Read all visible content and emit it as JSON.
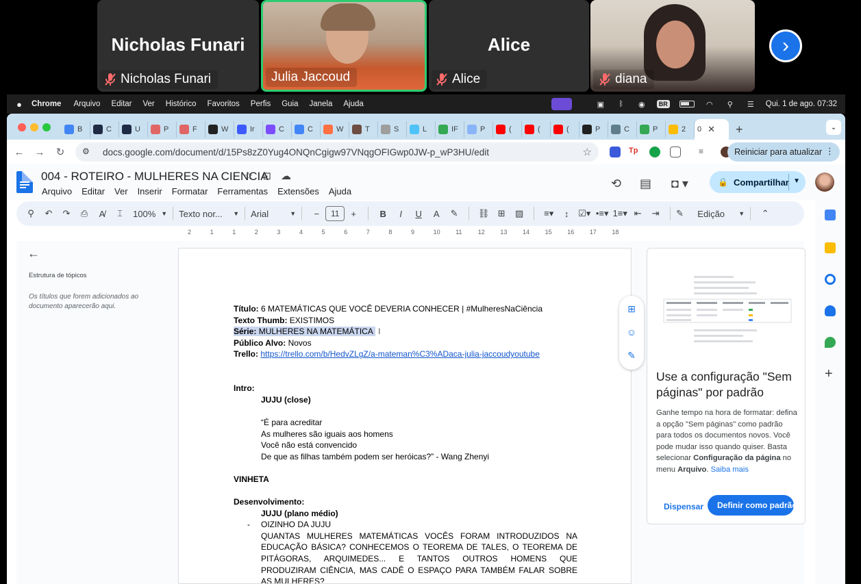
{
  "call": {
    "tiles": [
      {
        "big_name": "Nicholas Funari",
        "label": "Nicholas Funari",
        "muted": true
      },
      {
        "big_name": "",
        "label": "Julia Jaccoud",
        "muted": false,
        "active": true
      },
      {
        "big_name": "Alice",
        "label": "Alice",
        "muted": true
      },
      {
        "big_name": "",
        "label": "diana",
        "muted": true
      }
    ],
    "next_icon": "chevron-right-icon"
  },
  "menubar": {
    "app": "Chrome",
    "items": [
      "Arquivo",
      "Editar",
      "Ver",
      "Histórico",
      "Favoritos",
      "Perfis",
      "Guia",
      "Janela",
      "Ajuda"
    ],
    "input_badge": "BR",
    "clock": "Qui. 1 de ago.  07:32"
  },
  "browser": {
    "tabs": [
      {
        "label": "B",
        "color": "#4285f4"
      },
      {
        "label": "C",
        "color": "#1f2a44"
      },
      {
        "label": "U",
        "color": "#1f2a44"
      },
      {
        "label": "P",
        "color": "#e06666"
      },
      {
        "label": "F",
        "color": "#e06666"
      },
      {
        "label": "W",
        "color": "#222222"
      },
      {
        "label": "Ir",
        "color": "#3d5afe"
      },
      {
        "label": "C",
        "color": "#7c4dff"
      },
      {
        "label": "C",
        "color": "#4285f4"
      },
      {
        "label": "W",
        "color": "#ff7043"
      },
      {
        "label": "T",
        "color": "#6d4c41"
      },
      {
        "label": "S",
        "color": "#9e9e9e"
      },
      {
        "label": "L",
        "color": "#4fc3f7"
      },
      {
        "label": "IF",
        "color": "#34a853"
      },
      {
        "label": "P",
        "color": "#8ab4f8"
      },
      {
        "label": "(",
        "color": "#ff0000"
      },
      {
        "label": "(",
        "color": "#ff0000"
      },
      {
        "label": "(",
        "color": "#ff0000"
      },
      {
        "label": "P",
        "color": "#212121"
      },
      {
        "label": "C",
        "color": "#607d8b"
      },
      {
        "label": "P",
        "color": "#34a853"
      },
      {
        "label": "2",
        "color": "#fbbc04"
      }
    ],
    "active_tab": "0",
    "url": "docs.google.com/document/d/15Ps8zZ0Yug4ONQnCgigw97VNqgOFIGwp0JW-p_wP3HU/edit",
    "restart_label": "Reiniciar para atualizar"
  },
  "docs": {
    "title": "004 - ROTEIRO  - MULHERES NA CIENCIA",
    "menus": [
      "Arquivo",
      "Editar",
      "Ver",
      "Inserir",
      "Formatar",
      "Ferramentas",
      "Extensões",
      "Ajuda"
    ],
    "share_label": "Compartilhar",
    "toolbar": {
      "zoom": "100%",
      "style": "Texto nor...",
      "font": "Arial",
      "size": "11",
      "mode": "Edição"
    },
    "ruler_ticks": [
      "2",
      "1",
      "1",
      "2",
      "3",
      "4",
      "5",
      "6",
      "7",
      "8",
      "9",
      "10",
      "11",
      "12",
      "13",
      "14",
      "15",
      "16",
      "17",
      "18"
    ],
    "outline": {
      "title": "Estrutura de tópicos",
      "hint": "Os títulos que forem adicionados ao documento aparecerão aqui."
    }
  },
  "content": {
    "meta": [
      {
        "label": "Título:",
        "value": " 6 MATEMÁTICAS QUE VOCÊ DEVERIA CONHECER | #MulheresNaCiência"
      },
      {
        "label": "Texto Thumb:",
        "value": " EXISTIMOS"
      },
      {
        "label": "Série:",
        "value": " MULHERES NA MATEMÁTICA"
      },
      {
        "label": "Público Alvo:",
        "value": " Novos"
      },
      {
        "label": "Trello:",
        "value": "https://trello.com/b/HedvZLgZ/a-mateman%C3%ADaca-julia-jaccoudyoutube"
      }
    ],
    "intro_label": "Intro:",
    "intro_speaker": "JUJU (close)",
    "quote": [
      "“É para acreditar",
      "As mulheres são iguais aos homens",
      "Você não está convencido",
      "De que as filhas também podem ser heróicas?” - Wang Zhenyi"
    ],
    "vinheta": "VINHETA",
    "dev_label": "Desenvolvimento:",
    "dev_speaker": "JUJU (plano médio)",
    "bullet": "OIZINHO DA JUJU",
    "paragraph_lines": [
      "QUANTAS MULHERES MATEMÁTICAS VOCÊS FORAM INTRODUZIDOS NA",
      "EDUCAÇÃO BÁSICA? CONHECEMOS O TEOREMA DE TALES, O TEOREMA DE",
      "PITÁGORAS, ARQUIMEDES... E TANTOS OUTROS HOMENS QUE",
      "PRODUZIRAM CIÊNCIA, MAS CADÊ O ESPAÇO PARA TAMBÉM FALAR SOBRE",
      "AS MULHERES?"
    ]
  },
  "promo": {
    "title": "Use a configuração \"Sem páginas\" por padrão",
    "body_pre": "Ganhe tempo na hora de formatar: defina a opção \"Sem páginas\" como padrão para todos os documentos novos. Você pode mudar isso quando quiser. Basta selecionar ",
    "body_bold1": "Configuração da página",
    "body_mid": " no menu ",
    "body_bold2": "Arquivo",
    "body_end": ". ",
    "link": "Saiba mais",
    "dismiss": "Dispensar",
    "set_default": "Definir como padrão"
  }
}
